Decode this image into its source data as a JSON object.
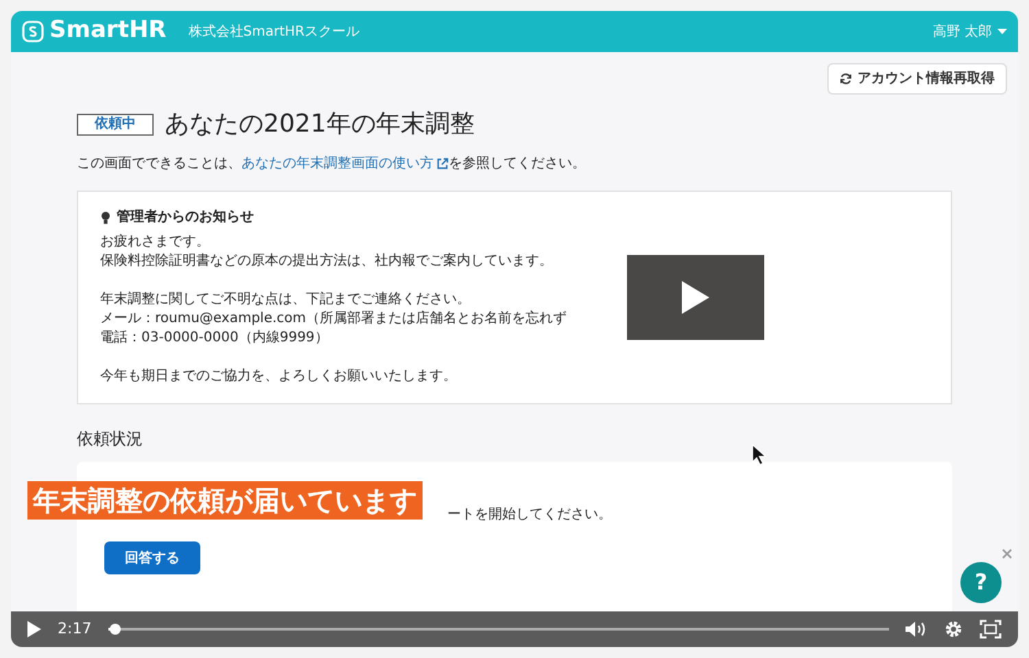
{
  "app_bar": {
    "logo": "SmartHR",
    "company": "株式会社SmartHRスクール",
    "user": "高野 太郎"
  },
  "account_button": "アカウント情報再取得",
  "status_badge": "依頼中",
  "title": "あなたの2021年の年末調整",
  "intro": {
    "before": "この画面でできることは、",
    "link": "あなたの年末調整画面の使い方",
    "after": "を参照してください。"
  },
  "notice": {
    "heading": "管理者からのお知らせ",
    "paragraphs": [
      [
        "お疲れさまです。",
        "保険料控除証明書などの原本の提出方法は、社内報でご案内しています。"
      ],
      [
        "年末調整に関してご不明な点は、下記までご連絡ください。",
        "メール：roumu@example.com（所属部署または店舗名とお名前を忘れず",
        "電話：03-0000-0000（内線9999）"
      ],
      [
        "今年も期日までのご協力を、よろしくお願いいたします。"
      ]
    ]
  },
  "section_title": "依頼状況",
  "task": {
    "description": "ートを開始してください。",
    "button": "回答する"
  },
  "caption": "年末調整の依頼が届いています",
  "help": "?",
  "player": {
    "time": "2:17",
    "level": 0.01
  }
}
